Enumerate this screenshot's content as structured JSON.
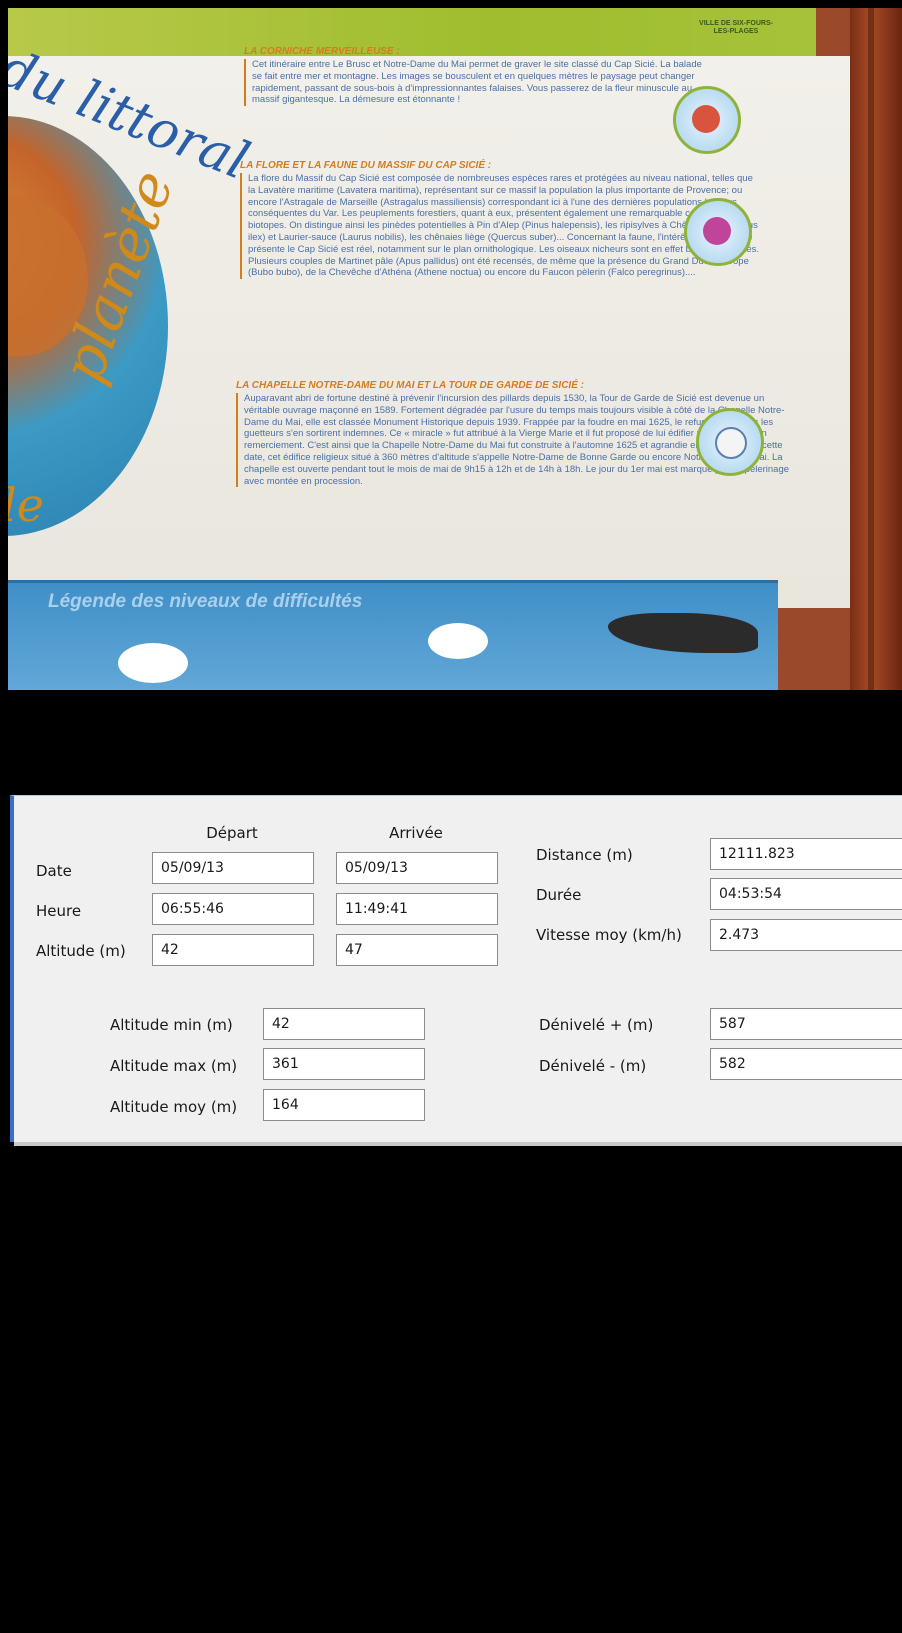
{
  "photo": {
    "board_header_logo": "VILLE DE SIX-FOURS-LES-PLAGES",
    "script_top": "du littoral",
    "script_side": "planète",
    "script_bottom": "le",
    "legend_title": "Légende des niveaux de difficultés",
    "sections": [
      {
        "title": "LA CORNICHE MERVEILLEUSE :",
        "body": "Cet itinéraire entre Le Brusc et Notre-Dame du Mai permet de graver le site classé du Cap Sicié. La balade se fait entre mer et montagne. Les images se bousculent et en quelques mètres le paysage peut changer rapidement, passant de sous-bois à d'impressionnantes falaises. Vous passerez de la fleur minuscule au massif gigantesque. La démesure est étonnante !"
      },
      {
        "title": "LA FLORE ET LA FAUNE DU MASSIF DU CAP SICIÉ :",
        "body": "La flore du Massif du Cap Sicié est composée de nombreuses espèces rares et protégées au niveau national, telles que la Lavatère maritime (Lavatera maritima), représentant sur ce massif la population la plus importante de Provence; ou encore l'Astragale de Marseille (Astragalus massiliensis) correspondant ici à l'une des dernières populations les plus conséquentes du Var. Les peuplements forestiers, quant à eux, présentent également une remarquable collection de biotopes. On distingue ainsi les pinèdes potentielles à Pin d'Alep (Pinus halepensis), les ripisylves à Chêne vert (Quercus ilex) et Laurier-sauce (Laurus nobilis), les chênaies liège (Quercus suber)... Concernant la faune, l'intérêt biologique que présente le Cap Sicié est réel, notamment sur le plan ornithologique. Les oiseaux nicheurs sont en effet bien représentés. Plusieurs couples de Martinet pâle (Apus pallidus) ont été recensés, de même que la présence du Grand Duc d'Europe (Bubo bubo), de la Chevêche d'Athéna (Athene noctua) ou encore du Faucon pèlerin (Falco peregrinus)...."
      },
      {
        "title": "LA CHAPELLE NOTRE-DAME DU MAI ET LA TOUR DE GARDE DE SICIÉ :",
        "body": "Auparavant abri de fortune destiné à prévenir l'incursion des pillards depuis 1530, la Tour de Garde de Sicié est devenue un véritable ouvrage maçonné en 1589. Fortement dégradée par l'usure du temps mais toujours visible à côté de la Chapelle Notre-Dame du Mai, elle est classée Monument Historique depuis 1939. Frappée par la foudre en mai 1625, le refuge brûla mais les guetteurs s'en sortirent indemnes. Ce « miracle » fut attribué à la Vierge Marie et il fut proposé de lui édifier un sanctuaire en remerciement. C'est ainsi que la Chapelle Notre-Dame du Mai fut construite à l'automne 1625 et agrandie en 1633. Depuis cette date, cet édifice religieux situé à 360 mètres d'altitude s'appelle Notre-Dame de Bonne Garde ou encore Notre-Dame du Mai. La chapelle est ouverte pendant tout le mois de mai de 9h15 à 12h et de 14h à 18h. Le jour du 1er mai est marqué par un pèlerinage avec montée en procession."
      }
    ]
  },
  "stats": {
    "columns": {
      "depart": "Départ",
      "arrivee": "Arrivée"
    },
    "rows": {
      "date": {
        "label": "Date",
        "depart": "05/09/13",
        "arrivee": "05/09/13"
      },
      "heure": {
        "label": "Heure",
        "depart": "06:55:46",
        "arrivee": "11:49:41"
      },
      "altitude": {
        "label": "Altitude (m)",
        "depart": "42",
        "arrivee": "47"
      }
    },
    "right": {
      "distance": {
        "label": "Distance (m)",
        "value": "12111.823"
      },
      "duree": {
        "label": "Durée",
        "value": "04:53:54"
      },
      "vitesse": {
        "label": "Vitesse moy (km/h)",
        "value": "2.473"
      }
    },
    "altitudes": {
      "min": {
        "label": "Altitude min (m)",
        "value": "42"
      },
      "max": {
        "label": "Altitude max (m)",
        "value": "361"
      },
      "moy": {
        "label": "Altitude moy (m)",
        "value": "164"
      }
    },
    "denivele": {
      "plus": {
        "label": "Dénivelé + (m)",
        "value": "587"
      },
      "minus": {
        "label": "Dénivelé - (m)",
        "value": "582"
      }
    }
  }
}
